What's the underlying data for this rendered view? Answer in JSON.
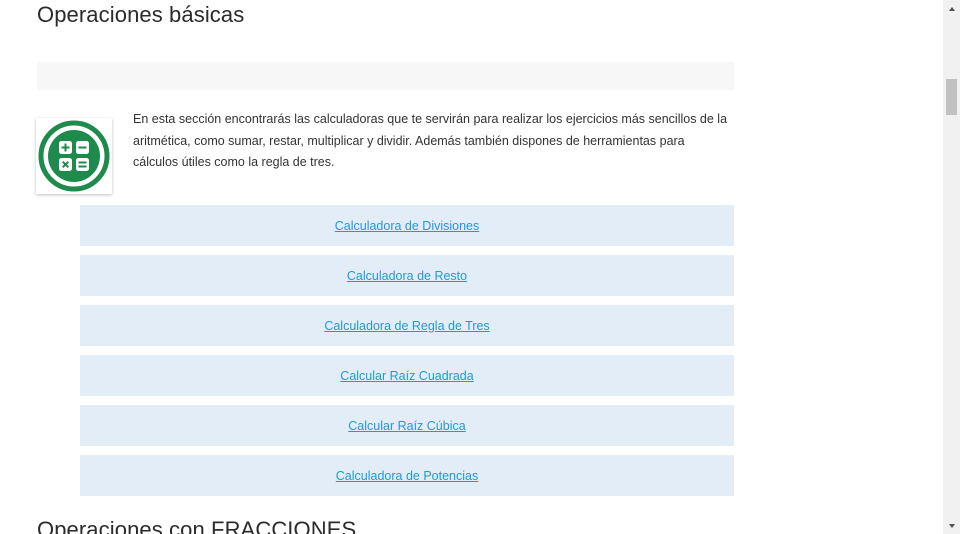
{
  "section": {
    "title": "Operaciones básicas",
    "intro": "En esta sección encontrarás las calculadoras que te servirán para realizar los ejercicios más sencillos de la aritmética, como sumar, restar, multiplicar y dividir. Además también dispones de herramientas para cálculos útiles como la regla de tres.",
    "icon": "calculator-icon",
    "links": [
      {
        "label": "Calculadora de Divisiones"
      },
      {
        "label": "Calculadora de Resto"
      },
      {
        "label": "Calculadora de Regla de Tres"
      },
      {
        "label": "Calcular Raíz Cuadrada"
      },
      {
        "label": "Calcular Raíz Cúbica"
      },
      {
        "label": "Calculadora de Potencias"
      }
    ]
  },
  "next_section": {
    "title": "Operaciones con FRACCIONES"
  },
  "colors": {
    "icon_green": "#1e8a4c",
    "link_bg": "#e2edf8",
    "link_text": "#1e9bd7"
  }
}
